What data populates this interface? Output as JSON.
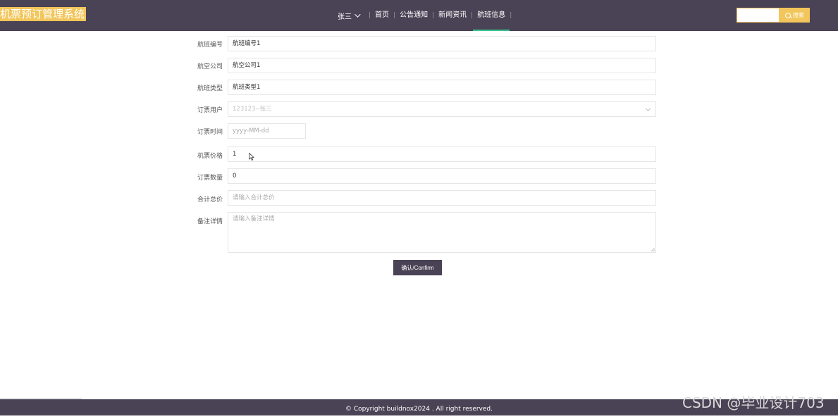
{
  "header": {
    "logo": "机票预订管理系统",
    "user": "张三",
    "nav": [
      "首页",
      "公告通知",
      "新闻资讯",
      "航班信息"
    ],
    "search_button": "搜索",
    "search_placeholder": ""
  },
  "form": {
    "flight_no": {
      "label": "航班编号",
      "value": "航班编号1"
    },
    "airline": {
      "label": "航空公司",
      "value": "航空公司1"
    },
    "flight_type": {
      "label": "航班类型",
      "value": "航班类型1"
    },
    "booking_user": {
      "label": "订票用户",
      "value": "123123--张三"
    },
    "booking_time": {
      "label": "订票时间",
      "placeholder": "yyyy-MM-dd"
    },
    "ticket_price": {
      "label": "机票价格",
      "value": "1"
    },
    "ticket_count": {
      "label": "订票数量",
      "value": "0"
    },
    "total_price": {
      "label": "合计总价",
      "placeholder": "请输入合计总价"
    },
    "remarks": {
      "label": "备注详情",
      "placeholder": "请输入备注详情"
    },
    "confirm_button": "确认/Confirm"
  },
  "footer": {
    "copyright": "© Copyright buildnox2024 . All right reserved."
  },
  "watermark": "CSDN @毕业设计703",
  "colors": {
    "header_bg": "#4a4255",
    "accent_yellow": "#f2c65b",
    "active_underline": "#3ec28f"
  }
}
